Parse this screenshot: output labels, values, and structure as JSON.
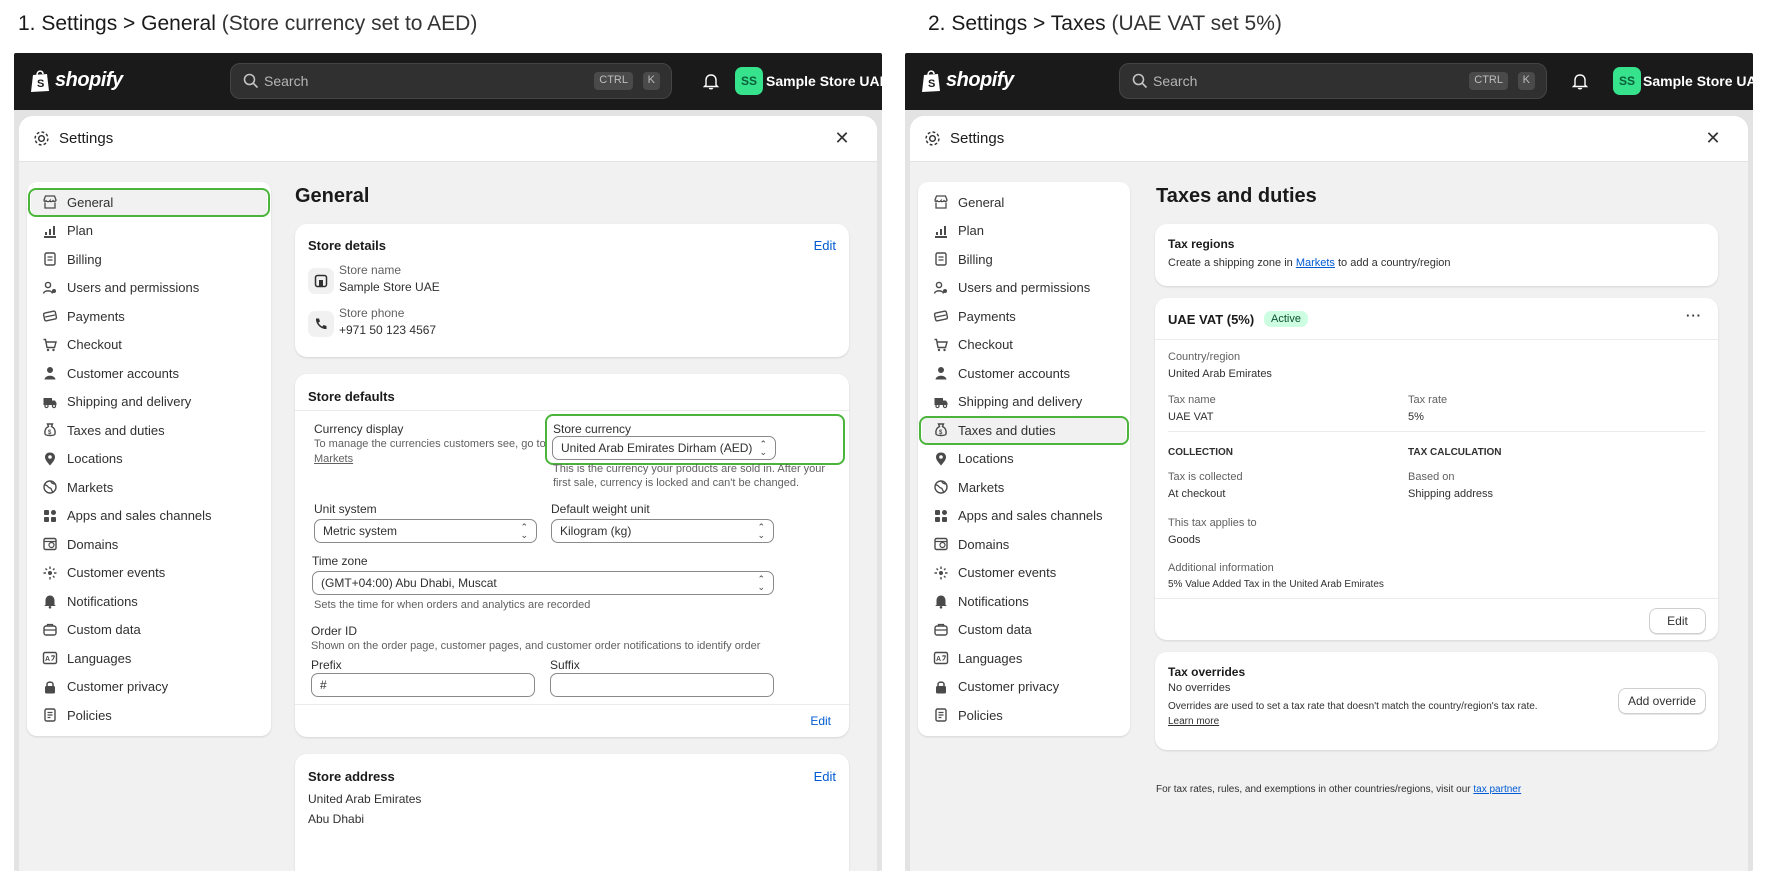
{
  "captions": [
    {
      "step": "1. Settings > General",
      "note": "(Store currency set to AED)"
    },
    {
      "step": "2. Settings > Taxes",
      "note": "(UAE VAT set 5%)"
    }
  ],
  "topbar": {
    "logo_text": "shopify",
    "search_placeholder": "Search",
    "shortcut_ctrl": "CTRL",
    "shortcut_k": "K",
    "avatar_initials": "SS",
    "store_name": "Sample Store UAE"
  },
  "modal": {
    "title": "Settings"
  },
  "nav": [
    {
      "label": "General",
      "icon": "store-icon"
    },
    {
      "label": "Plan",
      "icon": "plan-icon"
    },
    {
      "label": "Billing",
      "icon": "billing-icon"
    },
    {
      "label": "Users and permissions",
      "icon": "users-icon"
    },
    {
      "label": "Payments",
      "icon": "payments-icon"
    },
    {
      "label": "Checkout",
      "icon": "cart-icon"
    },
    {
      "label": "Customer accounts",
      "icon": "person-icon"
    },
    {
      "label": "Shipping and delivery",
      "icon": "truck-icon"
    },
    {
      "label": "Taxes and duties",
      "icon": "tax-icon"
    },
    {
      "label": "Locations",
      "icon": "location-icon"
    },
    {
      "label": "Markets",
      "icon": "globe-icon"
    },
    {
      "label": "Apps and sales channels",
      "icon": "apps-icon"
    },
    {
      "label": "Domains",
      "icon": "domain-icon"
    },
    {
      "label": "Customer events",
      "icon": "events-icon"
    },
    {
      "label": "Notifications",
      "icon": "bell-icon"
    },
    {
      "label": "Custom data",
      "icon": "data-icon"
    },
    {
      "label": "Languages",
      "icon": "language-icon"
    },
    {
      "label": "Customer privacy",
      "icon": "lock-icon"
    },
    {
      "label": "Policies",
      "icon": "policy-icon"
    }
  ],
  "general": {
    "page_title": "General",
    "store_details": {
      "title": "Store details",
      "edit": "Edit",
      "store_name_label": "Store name",
      "store_name_value": "Sample Store UAE",
      "store_phone_label": "Store phone",
      "store_phone_value": "+971 50 123 4567"
    },
    "store_defaults": {
      "title": "Store defaults",
      "currency_display_label": "Currency display",
      "currency_display_help": "To manage the currencies customers see, go to",
      "currency_display_link": "Markets",
      "store_currency_label": "Store currency",
      "store_currency_value": "United Arab Emirates Dirham (AED)",
      "store_currency_help_1": "This is the currency your products are sold in. After your",
      "store_currency_help_2": "first sale, currency is locked and can't be changed.",
      "unit_system_label": "Unit system",
      "unit_system_value": "Metric system",
      "weight_unit_label": "Default weight unit",
      "weight_unit_value": "Kilogram (kg)",
      "time_zone_label": "Time zone",
      "time_zone_value": "(GMT+04:00) Abu Dhabi, Muscat",
      "time_zone_help": "Sets the time for when orders and analytics are recorded",
      "order_id_label": "Order ID",
      "order_id_help": "Shown on the order page, customer pages, and customer order notifications to identify order",
      "prefix_label": "Prefix",
      "prefix_value": "#",
      "suffix_label": "Suffix",
      "suffix_value": "",
      "edit": "Edit"
    },
    "store_address": {
      "title": "Store address",
      "edit": "Edit",
      "line1": "United Arab Emirates",
      "line2": "Abu Dhabi"
    }
  },
  "taxes": {
    "page_title": "Taxes and duties",
    "tax_regions": {
      "title": "Tax regions",
      "text_before": "Create a shipping zone in",
      "link": "Markets",
      "text_after": "to add a country/region"
    },
    "vat": {
      "title": "UAE VAT (5%)",
      "badge": "Active",
      "more": "···",
      "country_label": "Country/region",
      "country_value": "United Arab Emirates",
      "tax_name_label": "Tax name",
      "tax_name_value": "UAE VAT",
      "tax_rate_label": "Tax rate",
      "tax_rate_value": "5%",
      "collection_heading": "COLLECTION",
      "calculation_heading": "TAX CALCULATION",
      "collected_label": "Tax is collected",
      "collected_value": "At checkout",
      "based_on_label": "Based on",
      "based_on_value": "Shipping address",
      "applies_label": "This tax applies to",
      "applies_value": "Goods",
      "additional_label": "Additional information",
      "additional_value": "5% Value Added Tax in the United Arab Emirates",
      "edit_button": "Edit"
    },
    "overrides": {
      "title": "Tax overrides",
      "none": "No overrides",
      "help": "Overrides are used to set a tax rate that doesn't match the country/region's tax rate.",
      "learn_more": "Learn more",
      "add_button": "Add override"
    },
    "footer_text": "For tax rates, rules, and exemptions in other countries/regions, visit our",
    "footer_link": "tax partner"
  },
  "colors": {
    "highlight": "#4ab53a",
    "topbar": "#1a1a1a",
    "link": "#005bd3",
    "avatar": "#36e28b"
  }
}
